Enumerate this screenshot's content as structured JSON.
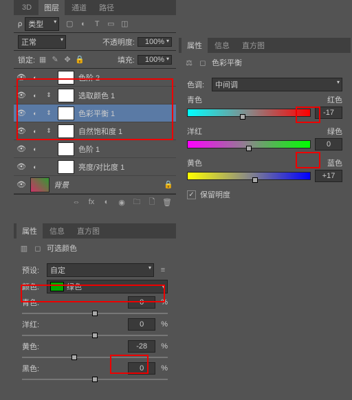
{
  "layers_panel": {
    "tabs": [
      "3D",
      "图层",
      "通道",
      "路径"
    ],
    "active_tab": 1,
    "filter": {
      "mode_label": "类型"
    },
    "blend": {
      "mode": "正常",
      "opacity_label": "不透明度:",
      "opacity_value": "100%"
    },
    "lock": {
      "label": "锁定:",
      "fill_label": "填充:",
      "fill_value": "100%"
    },
    "layers": [
      {
        "name": "色阶 2",
        "linked": false
      },
      {
        "name": "选取颜色 1",
        "linked": true
      },
      {
        "name": "色彩平衡 1",
        "linked": true,
        "selected": true
      },
      {
        "name": "自然饱和度 1",
        "linked": true
      },
      {
        "name": "色阶 1",
        "linked": false
      },
      {
        "name": "亮度/对比度 1",
        "linked": false
      }
    ],
    "bg_layer": "背景"
  },
  "props_right": {
    "tabs": [
      "属性",
      "信息",
      "直方图"
    ],
    "title": "色彩平衡",
    "tone_label": "色调:",
    "tone_value": "中间调",
    "sliders": [
      {
        "left": "青色",
        "right": "红色",
        "value": "-17",
        "grad": "linear-gradient(90deg,#0ff,#888,#f00)",
        "pos": 45
      },
      {
        "left": "洋红",
        "right": "绿色",
        "value": "0",
        "grad": "linear-gradient(90deg,#f0f,#888,#0f0)",
        "pos": 50
      },
      {
        "left": "黄色",
        "right": "蓝色",
        "value": "+17",
        "grad": "linear-gradient(90deg,#ff0,#888,#00f)",
        "pos": 55
      }
    ],
    "preserve_label": "保留明度",
    "preserve_checked": true
  },
  "props_bottom": {
    "tabs": [
      "属性",
      "信息",
      "直方图"
    ],
    "title": "可选颜色",
    "preset_label": "预设:",
    "preset_value": "自定",
    "color_label": "颜色:",
    "color_value": "绿色",
    "sliders": [
      {
        "label": "青色:",
        "value": "0"
      },
      {
        "label": "洋红:",
        "value": "0"
      },
      {
        "label": "黄色:",
        "value": "-28"
      },
      {
        "label": "黑色:",
        "value": "0"
      }
    ]
  }
}
